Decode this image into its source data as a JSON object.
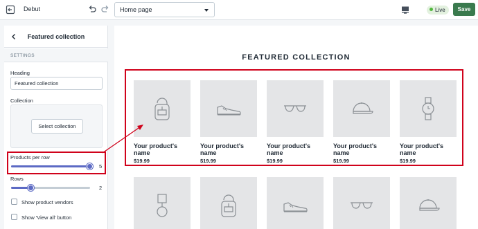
{
  "topbar": {
    "theme_name": "Debut",
    "page_selected": "Home page",
    "live_label": "Live",
    "save_label": "Save"
  },
  "sidebar": {
    "title": "Featured collection",
    "settings_label": "SETTINGS",
    "heading_label": "Heading",
    "heading_value": "Featured collection",
    "collection_label": "Collection",
    "select_collection_label": "Select collection",
    "products_per_row_label": "Products per row",
    "products_per_row_value": "5",
    "products_per_row_fraction": 1.0,
    "rows_label": "Rows",
    "rows_value": "2",
    "rows_fraction": 0.25,
    "show_vendors_label": "Show product vendors",
    "show_view_all_label": "Show 'View all' button"
  },
  "preview": {
    "section_title": "FEATURED COLLECTION",
    "products": [
      {
        "icon": "backpack-icon",
        "name": "Your product's name",
        "price": "$19.99"
      },
      {
        "icon": "sneaker-icon",
        "name": "Your product's name",
        "price": "$19.99"
      },
      {
        "icon": "sunglasses-icon",
        "name": "Your product's name",
        "price": "$19.99"
      },
      {
        "icon": "cap-icon",
        "name": "Your product's name",
        "price": "$19.99"
      },
      {
        "icon": "watch-icon",
        "name": "Your product's name",
        "price": "$19.99"
      }
    ],
    "second_row_icons": [
      "lamp-icon",
      "backpack-icon",
      "sneaker-icon",
      "sunglasses-icon",
      "cap-icon"
    ]
  },
  "colors": {
    "accent": "#5c6ac4",
    "save": "#3a7a4e",
    "highlight": "#d0021b",
    "live": "#50b83c"
  }
}
